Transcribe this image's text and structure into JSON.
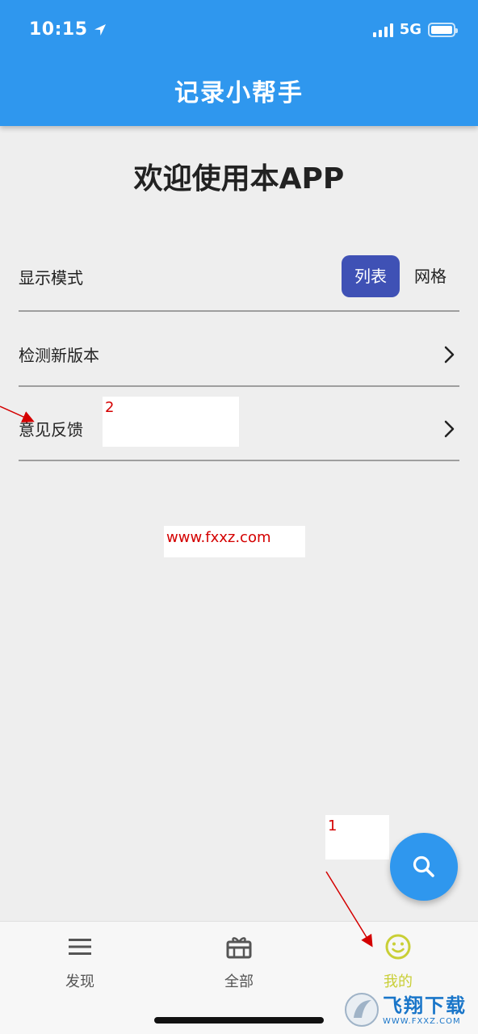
{
  "status_bar": {
    "time": "10:15",
    "network": "5G"
  },
  "header": {
    "title": "记录小帮手"
  },
  "welcome": "欢迎使用本APP",
  "settings": {
    "display_mode": {
      "label": "显示模式",
      "options": [
        "列表",
        "网格"
      ],
      "selected": "列表"
    },
    "check_update": {
      "label": "检测新版本"
    },
    "feedback": {
      "label": "意见反馈"
    }
  },
  "annotations": {
    "marker_1": "1",
    "marker_2": "2",
    "site_url": "www.fxxz.com"
  },
  "bottom_nav": {
    "items": [
      {
        "label": "发现",
        "icon": "menu-icon"
      },
      {
        "label": "全部",
        "icon": "gift-box-icon"
      },
      {
        "label": "我的",
        "icon": "smiley-icon",
        "active": true
      }
    ]
  },
  "watermark": {
    "text": "飞翔下载",
    "url": "WWW.FXXZ.COM"
  },
  "colors": {
    "primary": "#2f97ee",
    "toggle_active": "#3f51b5",
    "nav_active": "#c9cf36",
    "annotation": "#d40000"
  }
}
